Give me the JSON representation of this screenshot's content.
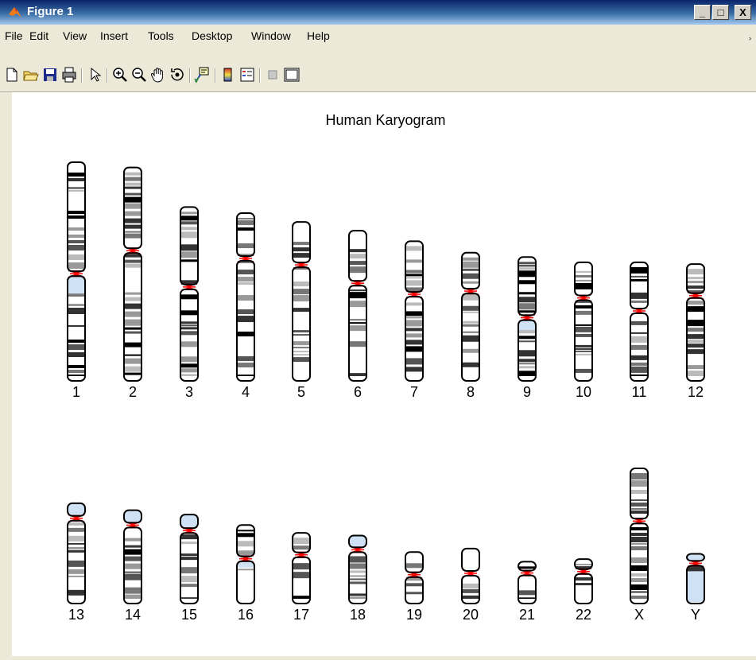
{
  "window": {
    "title": "Figure 1",
    "min_label": "_",
    "max_label": "□",
    "close_label": "X"
  },
  "menubar": {
    "items": [
      "File",
      "Edit",
      "View",
      "Insert",
      "Tools",
      "Desktop",
      "Window",
      "Help"
    ],
    "overflow_glyph": "›"
  },
  "toolbar": {
    "buttons": [
      "new-figure",
      "open-file",
      "save-figure",
      "print-figure",
      "edit-plot",
      "zoom-in",
      "zoom-out",
      "pan",
      "rotate-3d",
      "data-cursor",
      "insert-colorbar",
      "insert-legend",
      "hide-plot-tools",
      "show-plot-tools"
    ]
  },
  "colors": {
    "titlebar": "#0a246a",
    "centromere": "#ff0000",
    "acrocentric": "#cfe2f5",
    "frame": "#ece9d8"
  },
  "figure": {
    "title": "Human Karyogram",
    "chromosomes": [
      {
        "label": "1",
        "row": 1,
        "length": 249,
        "centromere": 0.51
      },
      {
        "label": "2",
        "row": 1,
        "length": 243,
        "centromere": 0.39
      },
      {
        "label": "3",
        "row": 1,
        "length": 198,
        "centromere": 0.46
      },
      {
        "label": "4",
        "row": 1,
        "length": 191,
        "centromere": 0.27
      },
      {
        "label": "5",
        "row": 1,
        "length": 181,
        "centromere": 0.27
      },
      {
        "label": "6",
        "row": 1,
        "length": 171,
        "centromere": 0.35
      },
      {
        "label": "7",
        "row": 1,
        "length": 159,
        "centromere": 0.38
      },
      {
        "label": "8",
        "row": 1,
        "length": 146,
        "centromere": 0.3
      },
      {
        "label": "9",
        "row": 1,
        "length": 141,
        "centromere": 0.49
      },
      {
        "label": "10",
        "row": 1,
        "length": 135,
        "centromere": 0.3
      },
      {
        "label": "11",
        "row": 1,
        "length": 135,
        "centromere": 0.41
      },
      {
        "label": "12",
        "row": 1,
        "length": 133,
        "centromere": 0.27
      },
      {
        "label": "13",
        "row": 2,
        "length": 115,
        "centromere": 0.15
      },
      {
        "label": "14",
        "row": 2,
        "length": 107,
        "centromere": 0.16
      },
      {
        "label": "15",
        "row": 2,
        "length": 102,
        "centromere": 0.18
      },
      {
        "label": "16",
        "row": 2,
        "length": 90,
        "centromere": 0.43
      },
      {
        "label": "17",
        "row": 2,
        "length": 81,
        "centromere": 0.31
      },
      {
        "label": "18",
        "row": 2,
        "length": 78,
        "centromere": 0.21
      },
      {
        "label": "19",
        "row": 2,
        "length": 59,
        "centromere": 0.44
      },
      {
        "label": "20",
        "row": 2,
        "length": 63,
        "centromere": 0.45
      },
      {
        "label": "21",
        "row": 2,
        "length": 48,
        "centromere": 0.27
      },
      {
        "label": "22",
        "row": 2,
        "length": 51,
        "centromere": 0.28
      },
      {
        "label": "X",
        "row": 2,
        "length": 155,
        "centromere": 0.39
      },
      {
        "label": "Y",
        "row": 2,
        "length": 57,
        "centromere": 0.19
      }
    ]
  }
}
